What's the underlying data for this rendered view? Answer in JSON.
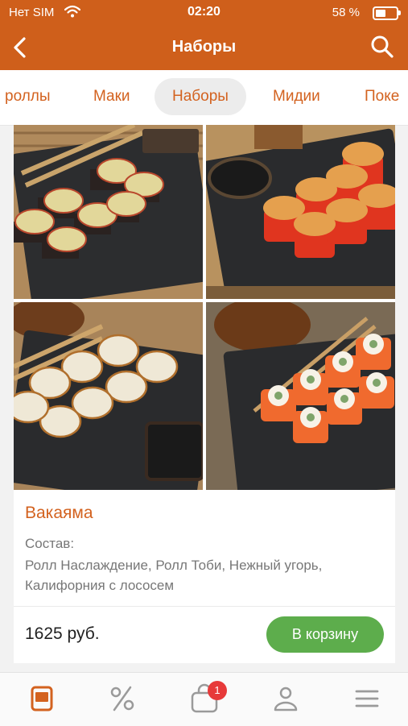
{
  "status": {
    "carrier": "Нет SIM",
    "time": "02:20",
    "battery": "58 %"
  },
  "header": {
    "title": "Наборы"
  },
  "tabs": [
    {
      "label": "роллы"
    },
    {
      "label": "Маки"
    },
    {
      "label": "Наборы",
      "active": true
    },
    {
      "label": "Мидии"
    },
    {
      "label": "Поке"
    }
  ],
  "product": {
    "name": "Вакаяма",
    "composition_label": "Состав:",
    "composition": "Ролл Наслаждение, Ролл Тоби, Нежный угорь, Калифорния с лососем",
    "price": "1625 руб.",
    "cart_button": "В корзину"
  },
  "bottom_nav": {
    "items": [
      "menu-icon",
      "discount-icon",
      "cart-icon",
      "profile-icon",
      "hamburger-icon"
    ],
    "cart_badge": "1"
  },
  "colors": {
    "brand": "#cf5f1b",
    "accent_text": "#d3621f",
    "button": "#5dad4c",
    "badge": "#e73a3a"
  }
}
